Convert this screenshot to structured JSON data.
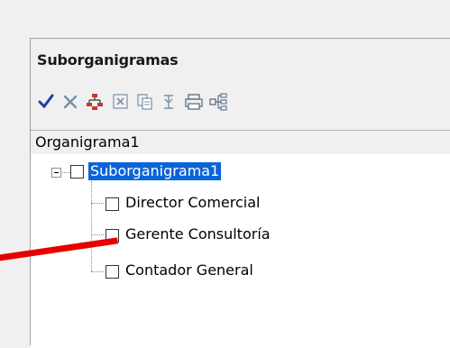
{
  "panel": {
    "title": "Suborganigramas"
  },
  "toolbar": {
    "buttons": [
      {
        "name": "accept-icon",
        "color": "#1f3fa6"
      },
      {
        "name": "cancel-icon",
        "color": "#7a8fa8"
      },
      {
        "name": "org-chart-icon",
        "color": "#c0392b"
      },
      {
        "name": "excel-export-icon",
        "color": "#7a8fa8"
      },
      {
        "name": "copy-icon",
        "color": "#7a8fa8"
      },
      {
        "name": "expand-collapse-icon",
        "color": "#7a8fa8"
      },
      {
        "name": "print-icon",
        "color": "#5a6f88"
      },
      {
        "name": "tree-icon",
        "color": "#5a6f88"
      }
    ]
  },
  "header": {
    "label": "Organigrama1"
  },
  "tree": {
    "root": {
      "label": "Suborganigrama1",
      "selected": true
    },
    "children": [
      {
        "label": "Director Comercial"
      },
      {
        "label": "Gerente Consultoría"
      },
      {
        "label": "Contador General"
      }
    ]
  },
  "colors": {
    "selection": "#0a64d8",
    "annotation_arrow": "#e60000"
  }
}
